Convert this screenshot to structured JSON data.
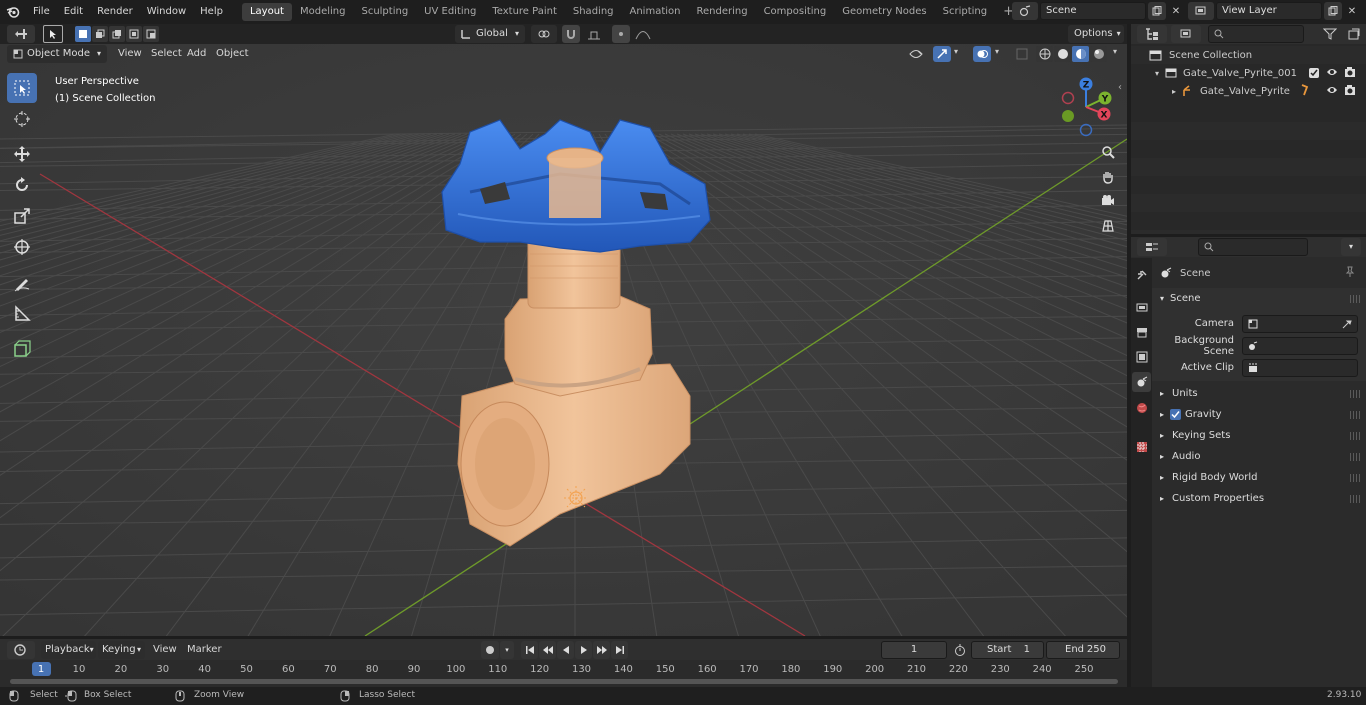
{
  "topbar": {
    "menus": [
      "File",
      "Edit",
      "Render",
      "Window",
      "Help"
    ],
    "workspaces": [
      "Layout",
      "Modeling",
      "Sculpting",
      "UV Editing",
      "Texture Paint",
      "Shading",
      "Animation",
      "Rendering",
      "Compositing",
      "Geometry Nodes",
      "Scripting"
    ],
    "active_workspace": "Layout",
    "add_tab": "+",
    "scene": "Scene",
    "view_layer": "View Layer"
  },
  "viewport_header": {
    "orientation": "Global",
    "options": "Options",
    "mode": "Object Mode",
    "menus": [
      "View",
      "Select",
      "Add",
      "Object"
    ]
  },
  "viewport": {
    "perspective": "User Perspective",
    "collection": "(1) Scene Collection",
    "gizmo_axes": [
      "Z",
      "Y",
      "X"
    ]
  },
  "outliner": {
    "root": "Scene Collection",
    "items": [
      {
        "label": "Gate_Valve_Pyrite_001"
      },
      {
        "label": "Gate_Valve_Pyrite"
      }
    ]
  },
  "properties": {
    "context": "Scene",
    "panel": "Scene",
    "fields": [
      {
        "label": "Camera",
        "icon": "camera-icon"
      },
      {
        "label": "Background Scene",
        "icon": "scene-icon"
      },
      {
        "label": "Active Clip",
        "icon": "clip-icon"
      }
    ],
    "sections": [
      "Units",
      "Gravity",
      "Keying Sets",
      "Audio",
      "Rigid Body World",
      "Custom Properties"
    ],
    "gravity_checked": true
  },
  "timeline": {
    "menus": [
      "Playback",
      "Keying",
      "View",
      "Marker"
    ],
    "current_frame": "1",
    "start_label": "Start",
    "start": "1",
    "end_label": "End",
    "end": "250",
    "ruler": [
      "1",
      "10",
      "20",
      "30",
      "40",
      "50",
      "60",
      "70",
      "80",
      "90",
      "100",
      "110",
      "120",
      "130",
      "140",
      "150",
      "160",
      "170",
      "180",
      "190",
      "200",
      "210",
      "220",
      "230",
      "240",
      "250"
    ]
  },
  "statusbar": {
    "select": "Select",
    "box_select": "Box Select",
    "zoom_view": "Zoom View",
    "lasso_select": "Lasso Select",
    "version": "2.93.10"
  },
  "colors": {
    "accent": "#4772b3",
    "x_axis": "#c0394a",
    "y_axis": "#7ba32c",
    "valve_body": "#e8b68a",
    "handwheel": "#2f6fd0"
  }
}
